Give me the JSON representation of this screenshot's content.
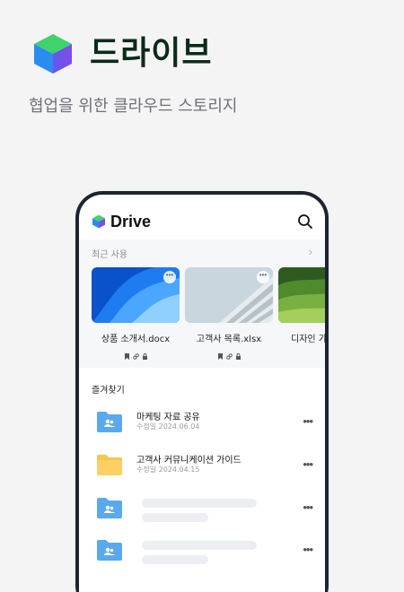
{
  "hero": {
    "title": "드라이브",
    "subtitle": "협업을 위한 클라우드 스토리지"
  },
  "app": {
    "title": "Drive",
    "search_icon": "search-icon"
  },
  "recent": {
    "label": "최근 사용",
    "files": [
      {
        "name": "상품 소개서.docx",
        "thumb": "blue-abstract"
      },
      {
        "name": "고객사 목록.xlsx",
        "thumb": "building"
      },
      {
        "name": "디자인 가",
        "thumb": "green-hills"
      }
    ]
  },
  "favorites": {
    "label": "즐겨찾기",
    "items": [
      {
        "title": "마케팅 자료 공유",
        "meta": "수정일 2024.06.04",
        "icon": "shared-folder-icon"
      },
      {
        "title": "고객사 커뮤니케이션 가이드",
        "meta": "수정일 2024.04.15",
        "icon": "folder-icon"
      }
    ]
  },
  "colors": {
    "brand_dark": "#0b2a1a",
    "folder_blue": "#5aa8ee",
    "folder_yellow": "#fbc54a",
    "phone_frame": "#1d2430"
  }
}
